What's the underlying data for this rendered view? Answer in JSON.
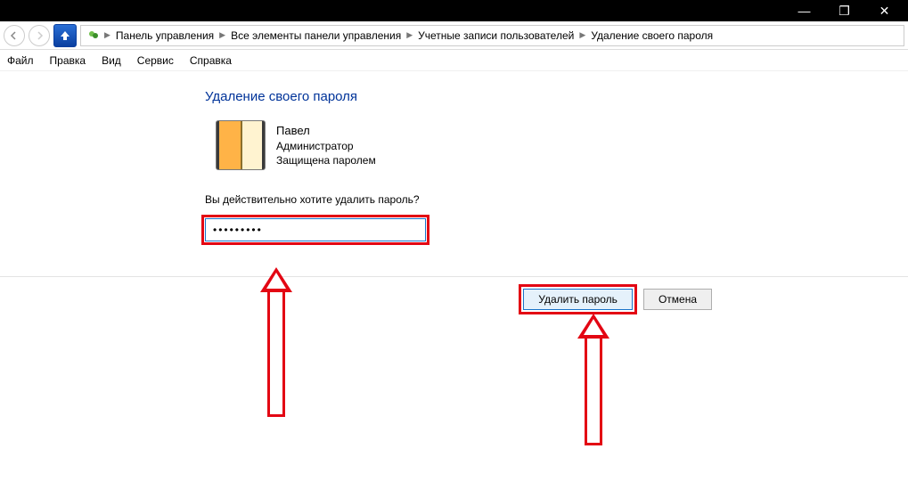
{
  "titlebar": {
    "minimize": "—",
    "maximize": "❐",
    "close": "✕"
  },
  "breadcrumb": {
    "items": [
      "Панель управления",
      "Все элементы панели управления",
      "Учетные записи пользователей",
      "Удаление своего пароля"
    ]
  },
  "menu": {
    "file": "Файл",
    "edit": "Правка",
    "view": "Вид",
    "service": "Сервис",
    "help": "Справка"
  },
  "page": {
    "heading": "Удаление своего пароля",
    "user": {
      "name": "Павел",
      "role": "Администратор",
      "status": "Защищена паролем"
    },
    "prompt": "Вы действительно хотите удалить пароль?",
    "password_value": "•••••••••"
  },
  "buttons": {
    "delete": "Удалить пароль",
    "cancel": "Отмена"
  }
}
